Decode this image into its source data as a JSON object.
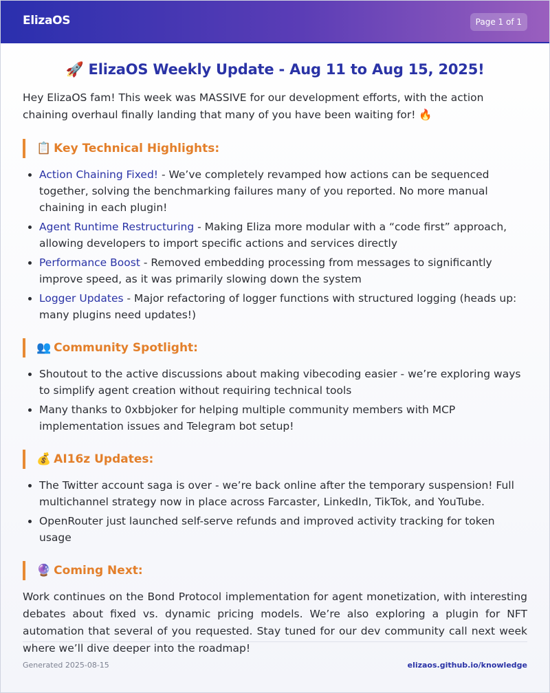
{
  "header": {
    "brand": "ElizaOS",
    "page_indicator": "Page 1 of 1"
  },
  "title": "🚀 ElizaOS Weekly Update - Aug 11 to Aug 15, 2025!",
  "intro": "Hey ElizaOS fam! This week was MASSIVE for our development efforts, with the action chaining overhaul finally landing that many of you have been waiting for! 🔥",
  "sections": {
    "highlights": {
      "emoji": "📋",
      "heading": "Key Technical Highlights:",
      "items": [
        {
          "title": "Action Chaining Fixed!",
          "text": " - We’ve completely revamped how actions can be sequenced together, solving the benchmarking failures many of you reported. No more manual chaining in each plugin!"
        },
        {
          "title": "Agent Runtime Restructuring",
          "text": " - Making Eliza more modular with a “code first” approach, allowing developers to import specific actions and services directly"
        },
        {
          "title": "Performance Boost",
          "text": " - Removed embedding processing from messages to significantly improve speed, as it was primarily slowing down the system"
        },
        {
          "title": "Logger Updates",
          "text": " - Major refactoring of logger functions with structured logging (heads up: many plugins need updates!)"
        }
      ]
    },
    "community": {
      "emoji": "👥",
      "heading": "Community Spotlight:",
      "items": [
        "Shoutout to the active discussions about making vibecoding easier - we’re exploring ways to simplify agent creation without requiring technical tools",
        "Many thanks to 0xbbjoker for helping multiple community members with MCP implementation issues and Telegram bot setup!"
      ]
    },
    "ai16z": {
      "emoji": "💰",
      "heading": "AI16z Updates:",
      "items": [
        "The Twitter account saga is over - we’re back online after the temporary suspension! Full multichannel strategy now in place across Farcaster, LinkedIn, TikTok, and YouTube.",
        "OpenRouter just launched self-serve refunds and improved activity tracking for token usage"
      ]
    },
    "next": {
      "emoji": "🔮",
      "heading": "Coming Next:",
      "text": "Work continues on the Bond Protocol implementation for agent monetization, with interesting debates about fixed vs. dynamic pricing models. We’re also exploring a plugin for NFT automation that several of you requested. Stay tuned for our dev community call next week where we’ll dive deeper into the roadmap!"
    }
  },
  "footer": {
    "generated": "Generated 2025-08-15",
    "link": "elizaos.github.io/knowledge"
  }
}
